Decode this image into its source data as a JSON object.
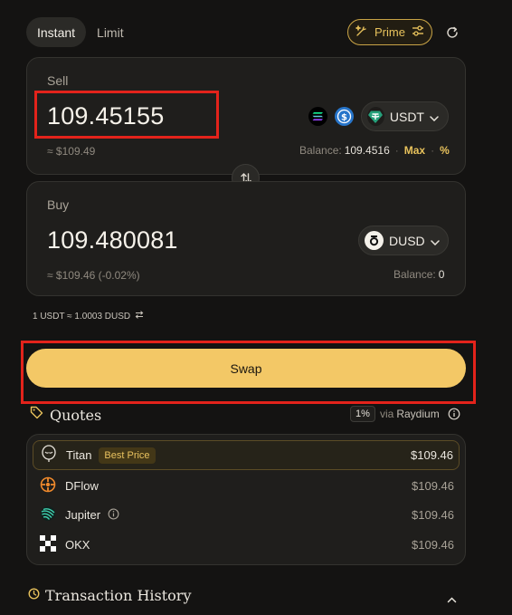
{
  "tabs": [
    "Instant",
    "Limit"
  ],
  "prime_label": "Prime",
  "sell": {
    "label": "Sell",
    "amount": "109.45155",
    "usd_value": "≈ $109.49",
    "token": "USDT",
    "balance_label": "Balance:",
    "balance_value": "109.4516",
    "max_label": "Max",
    "percent_label": "%"
  },
  "buy": {
    "label": "Buy",
    "amount": "109.480081",
    "usd_value": "≈ $109.46 (-0.02%)",
    "token": "DUSD",
    "balance_label": "Balance:",
    "balance_value": "0"
  },
  "rate": "1 USDT ≈ 1.0003 DUSD",
  "swap_label": "Swap",
  "quotes": {
    "title": "Quotes",
    "slippage": "1%",
    "via_label": "via",
    "via_value": "Raydium",
    "items": [
      {
        "name": "Titan",
        "badge": "Best Price",
        "price": "$109.46"
      },
      {
        "name": "DFlow",
        "price": "$109.46"
      },
      {
        "name": "Jupiter",
        "price": "$109.46"
      },
      {
        "name": "OKX",
        "price": "$109.46"
      }
    ]
  },
  "history": {
    "title": "Transaction History"
  },
  "colors": {
    "accent": "#f3c866",
    "highlight": "#e3231b",
    "background": "#141312"
  }
}
